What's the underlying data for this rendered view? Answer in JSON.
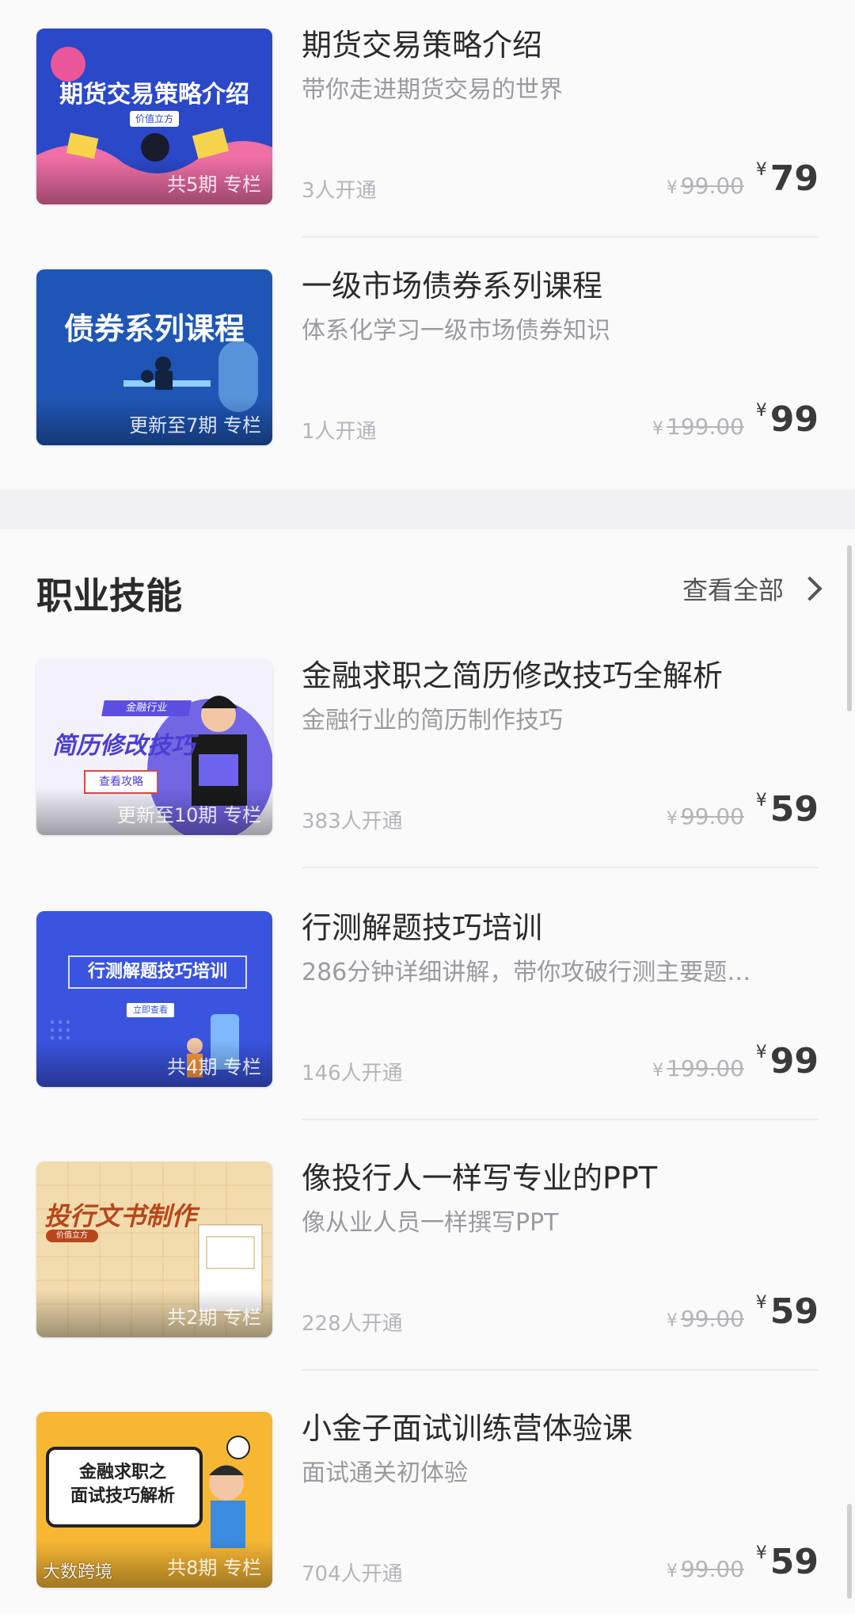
{
  "top_courses": [
    {
      "thumb_title": "期货交易策略介绍",
      "thumb_tag": "价值立方",
      "badge": "共5期 专栏",
      "title": "期货交易策略介绍",
      "subtitle": "带你走进期货交易的世界",
      "buyers": "3人开通",
      "yen": "¥",
      "orig_price": "99.00",
      "price": "79",
      "colors": {
        "bg": "#2b48c9",
        "accent": "#f06fa6"
      }
    },
    {
      "thumb_title": "债券系列课程",
      "badge": "更新至7期 专栏",
      "title": "一级市场债券系列课程",
      "subtitle": "体系化学习一级市场债券知识",
      "buyers": "1人开通",
      "yen": "¥",
      "orig_price": "199.00",
      "price": "99",
      "colors": {
        "bg": "#1f56b5",
        "accent": "#8fd0ff"
      }
    }
  ],
  "career_section": {
    "heading": "职业技能",
    "view_all": "查看全部",
    "courses": [
      {
        "thumb_title": "简历修改技巧",
        "thumb_tag": "金融行业",
        "thumb_button": "查看攻略",
        "badge": "更新至10期 专栏",
        "title": "金融求职之简历修改技巧全解析",
        "subtitle": "金融行业的简历制作技巧",
        "buyers": "383人开通",
        "yen": "¥",
        "orig_price": "99.00",
        "price": "59",
        "colors": {
          "bg": "#f3f1fb",
          "accent": "#5b4ee0"
        }
      },
      {
        "thumb_title": "行测解题技巧培训",
        "thumb_button": "立即查看",
        "badge": "共4期 专栏",
        "title": "行测解题技巧培训",
        "subtitle": "286分钟详细讲解，带你攻破行测主要题…",
        "buyers": "146人开通",
        "yen": "¥",
        "orig_price": "199.00",
        "price": "99",
        "colors": {
          "bg": "#3a54e0",
          "accent": "#ffffff"
        }
      },
      {
        "thumb_title": "投行文书制作",
        "thumb_tag": "价值立方",
        "badge": "共2期 专栏",
        "title": "像投行人一样写专业的PPT",
        "subtitle": "像从业人员一样撰写PPT",
        "buyers": "228人开通",
        "yen": "¥",
        "orig_price": "99.00",
        "price": "59",
        "colors": {
          "bg": "#f2dcae",
          "accent": "#b8471c"
        }
      },
      {
        "thumb_title": "金融求职之\n面试技巧解析",
        "badge": "共8期 专栏",
        "title": "小金子面试训练营体验课",
        "subtitle": "面试通关初体验",
        "buyers": "704人开通",
        "yen": "¥",
        "orig_price": "99.00",
        "price": "59",
        "colors": {
          "bg": "#f7b733",
          "accent": "#222222"
        }
      }
    ]
  },
  "watermark": "大数跨境"
}
